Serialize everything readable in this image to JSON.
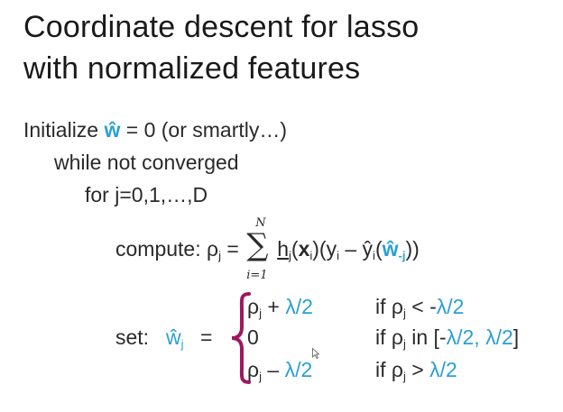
{
  "title": {
    "line1": "Coordinate descent for lasso",
    "line2": "with normalized features"
  },
  "algorithm": {
    "init_prefix": "Initialize ",
    "w_hat": "ŵ",
    "init_suffix": " = 0 (or smartly…)",
    "while": "while not converged",
    "for": "for j=0,1,…,D",
    "compute_label": "compute: ρ",
    "j": "j",
    "equals": " = ",
    "sum_top": "N",
    "sum_bottom": "i=1",
    "h": "h",
    "x_open": "(",
    "x": "x",
    "i": "i",
    "y_part1": ")(y",
    "y_part2": " – ŷ",
    "y_part3": "(",
    "minus_j": "-j",
    "close": "))",
    "set_label": "set:",
    "w_hat_j": "ŵ",
    "set_equals": "=",
    "cases": [
      {
        "expr_pre": "ρ",
        "expr_sub": "j",
        "expr_op": " + ",
        "expr_lam": "λ/2",
        "cond_pre": "if ρ",
        "cond_sub": "j",
        "cond_post": " < -",
        "cond_lam": "λ/2",
        "cond_tail": ""
      },
      {
        "expr_pre": "0",
        "expr_sub": "",
        "expr_op": "",
        "expr_lam": "",
        "cond_pre": "if ρ",
        "cond_sub": "j",
        "cond_post": " in [-",
        "cond_lam": "λ/2, λ/2",
        "cond_tail": "]"
      },
      {
        "expr_pre": "ρ",
        "expr_sub": "j",
        "expr_op": " – ",
        "expr_lam": "λ/2",
        "cond_pre": "if ρ",
        "cond_sub": "j",
        "cond_post": " > ",
        "cond_lam": "λ/2",
        "cond_tail": ""
      }
    ]
  },
  "colors": {
    "accent": "#2a9fd6",
    "brace": "#a0175e",
    "text": "#222222"
  },
  "icons": {
    "cursor": "mouse-pointer-icon"
  }
}
